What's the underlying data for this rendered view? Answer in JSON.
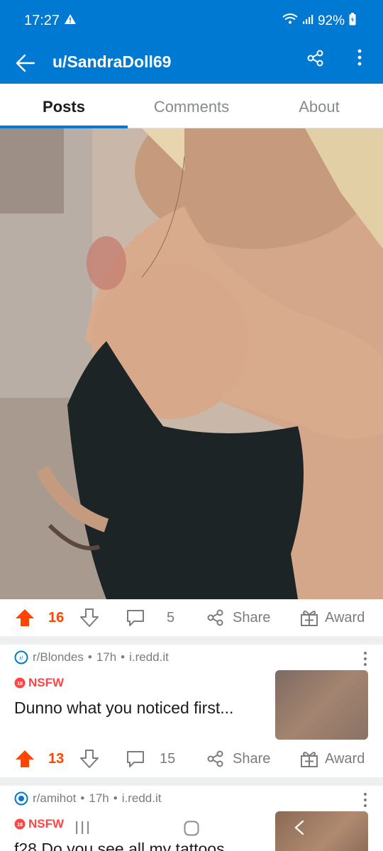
{
  "status": {
    "time": "17:27",
    "battery": "92%"
  },
  "appbar": {
    "title": "u/SandraDoll69"
  },
  "tabs": [
    {
      "label": "Posts"
    },
    {
      "label": "Comments"
    },
    {
      "label": "About"
    }
  ],
  "posts": [
    {
      "upvotes": "16",
      "comments": "5",
      "share_label": "Share",
      "award_label": "Award"
    },
    {
      "subreddit": "r/Blondes",
      "age": "17h",
      "domain": "i.redd.it",
      "nsfw": "NSFW",
      "title": "Dunno what you noticed first...",
      "upvotes": "13",
      "comments": "15",
      "share_label": "Share",
      "award_label": "Award"
    },
    {
      "subreddit": "r/amihot",
      "age": "17h",
      "domain": "i.redd.it",
      "nsfw": "NSFW",
      "title": "f28 Do you see all my tattoos"
    }
  ],
  "colors": {
    "brand": "#0079d3",
    "upvote": "#ff4500",
    "nsfw": "#ff4545"
  }
}
